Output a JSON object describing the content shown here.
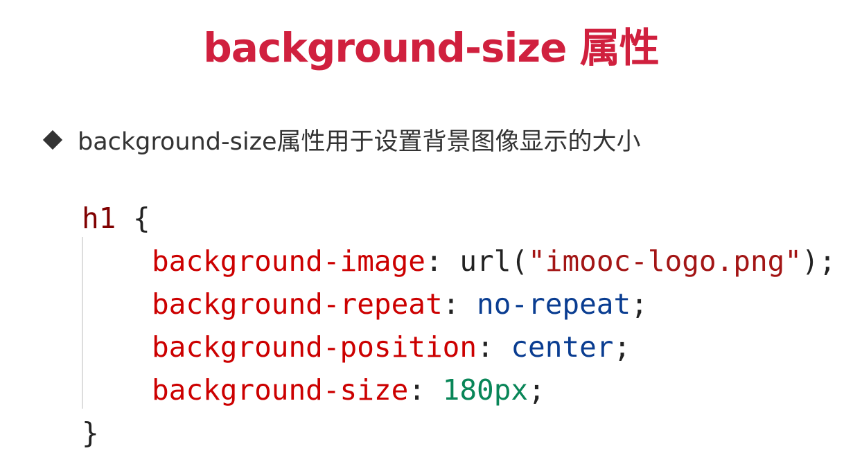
{
  "title": "background-size 属性",
  "bullet": {
    "icon": "diamond-bullet-icon",
    "text": "background-size属性用于设置背景图像显示的大小"
  },
  "code": {
    "selector": "h1",
    "open_brace": " {",
    "close_brace": "}",
    "declarations": [
      {
        "property": "background-image",
        "value_prefix": "url(",
        "value": "\"imooc-logo.png\"",
        "value_suffix": ")"
      },
      {
        "property": "background-repeat",
        "value": "no-repeat"
      },
      {
        "property": "background-position",
        "value": "center"
      },
      {
        "property": "background-size",
        "value": "180px"
      }
    ]
  },
  "colors": {
    "title": "#d0203e",
    "property": "#cc0000",
    "keyword": "#0a3d91",
    "number": "#098658",
    "selector": "#800000"
  }
}
